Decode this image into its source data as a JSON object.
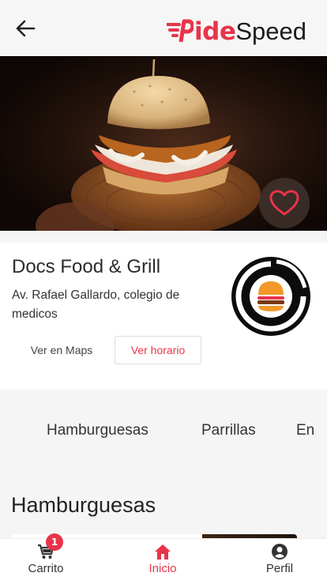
{
  "header": {
    "brand_part1": "ide",
    "brand_part2": "Speed"
  },
  "restaurant": {
    "name": "Docs Food & Grill",
    "address": "Av. Rafael Gallardo, colegio de medicos",
    "maps_label": "Ver en Maps",
    "schedule_label": "Ver horario"
  },
  "categories": [
    "Hamburguesas",
    "Parrillas",
    "En"
  ],
  "section": {
    "title": "Hamburguesas"
  },
  "nav": {
    "cart_label": "Carrito",
    "cart_badge": "1",
    "home_label": "Inicio",
    "profile_label": "Perfil"
  },
  "colors": {
    "accent": "#e8344a",
    "text": "#333333",
    "background": "#f5f5f5"
  },
  "icons": [
    "back-arrow-icon",
    "brand-logo-icon",
    "heart-icon",
    "cart-icon",
    "home-icon",
    "profile-icon"
  ]
}
